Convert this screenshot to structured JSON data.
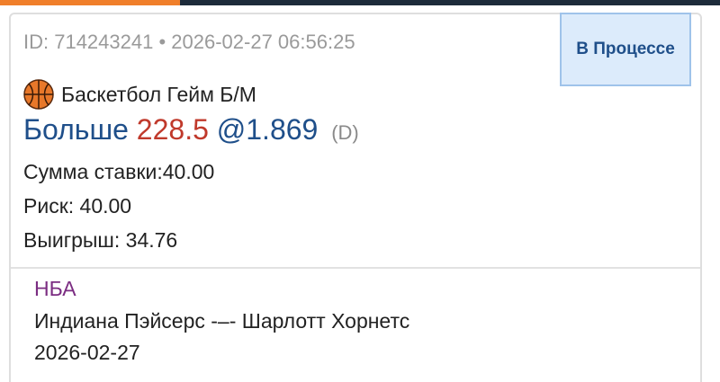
{
  "bet": {
    "id_line": "ID: 714243241 • 2026-02-27 06:56:25",
    "status": "В Процессе",
    "sport_label": "Баскетбол Гейм Б/М",
    "sport_icon": "basketball-icon",
    "selection": "Больше",
    "line_value": "228.5",
    "odds": "@1.869",
    "odds_format": "(D)",
    "stake_line": "Сумма ставки:40.00",
    "risk_line": "Риск: 40.00",
    "win_line": "Выигрыш: 34.76"
  },
  "event": {
    "league": "НБА",
    "match": "Индиана Пэйсерс -–- Шарлотт Хорнетс",
    "date": "2026-02-27"
  },
  "colors": {
    "accent": "#f07f2a",
    "header_dark": "#1d2b3a",
    "selection_blue": "#1f4f8a",
    "line_red": "#c0392b",
    "league_purple": "#7b2d82",
    "status_bg": "#dcebfb"
  }
}
